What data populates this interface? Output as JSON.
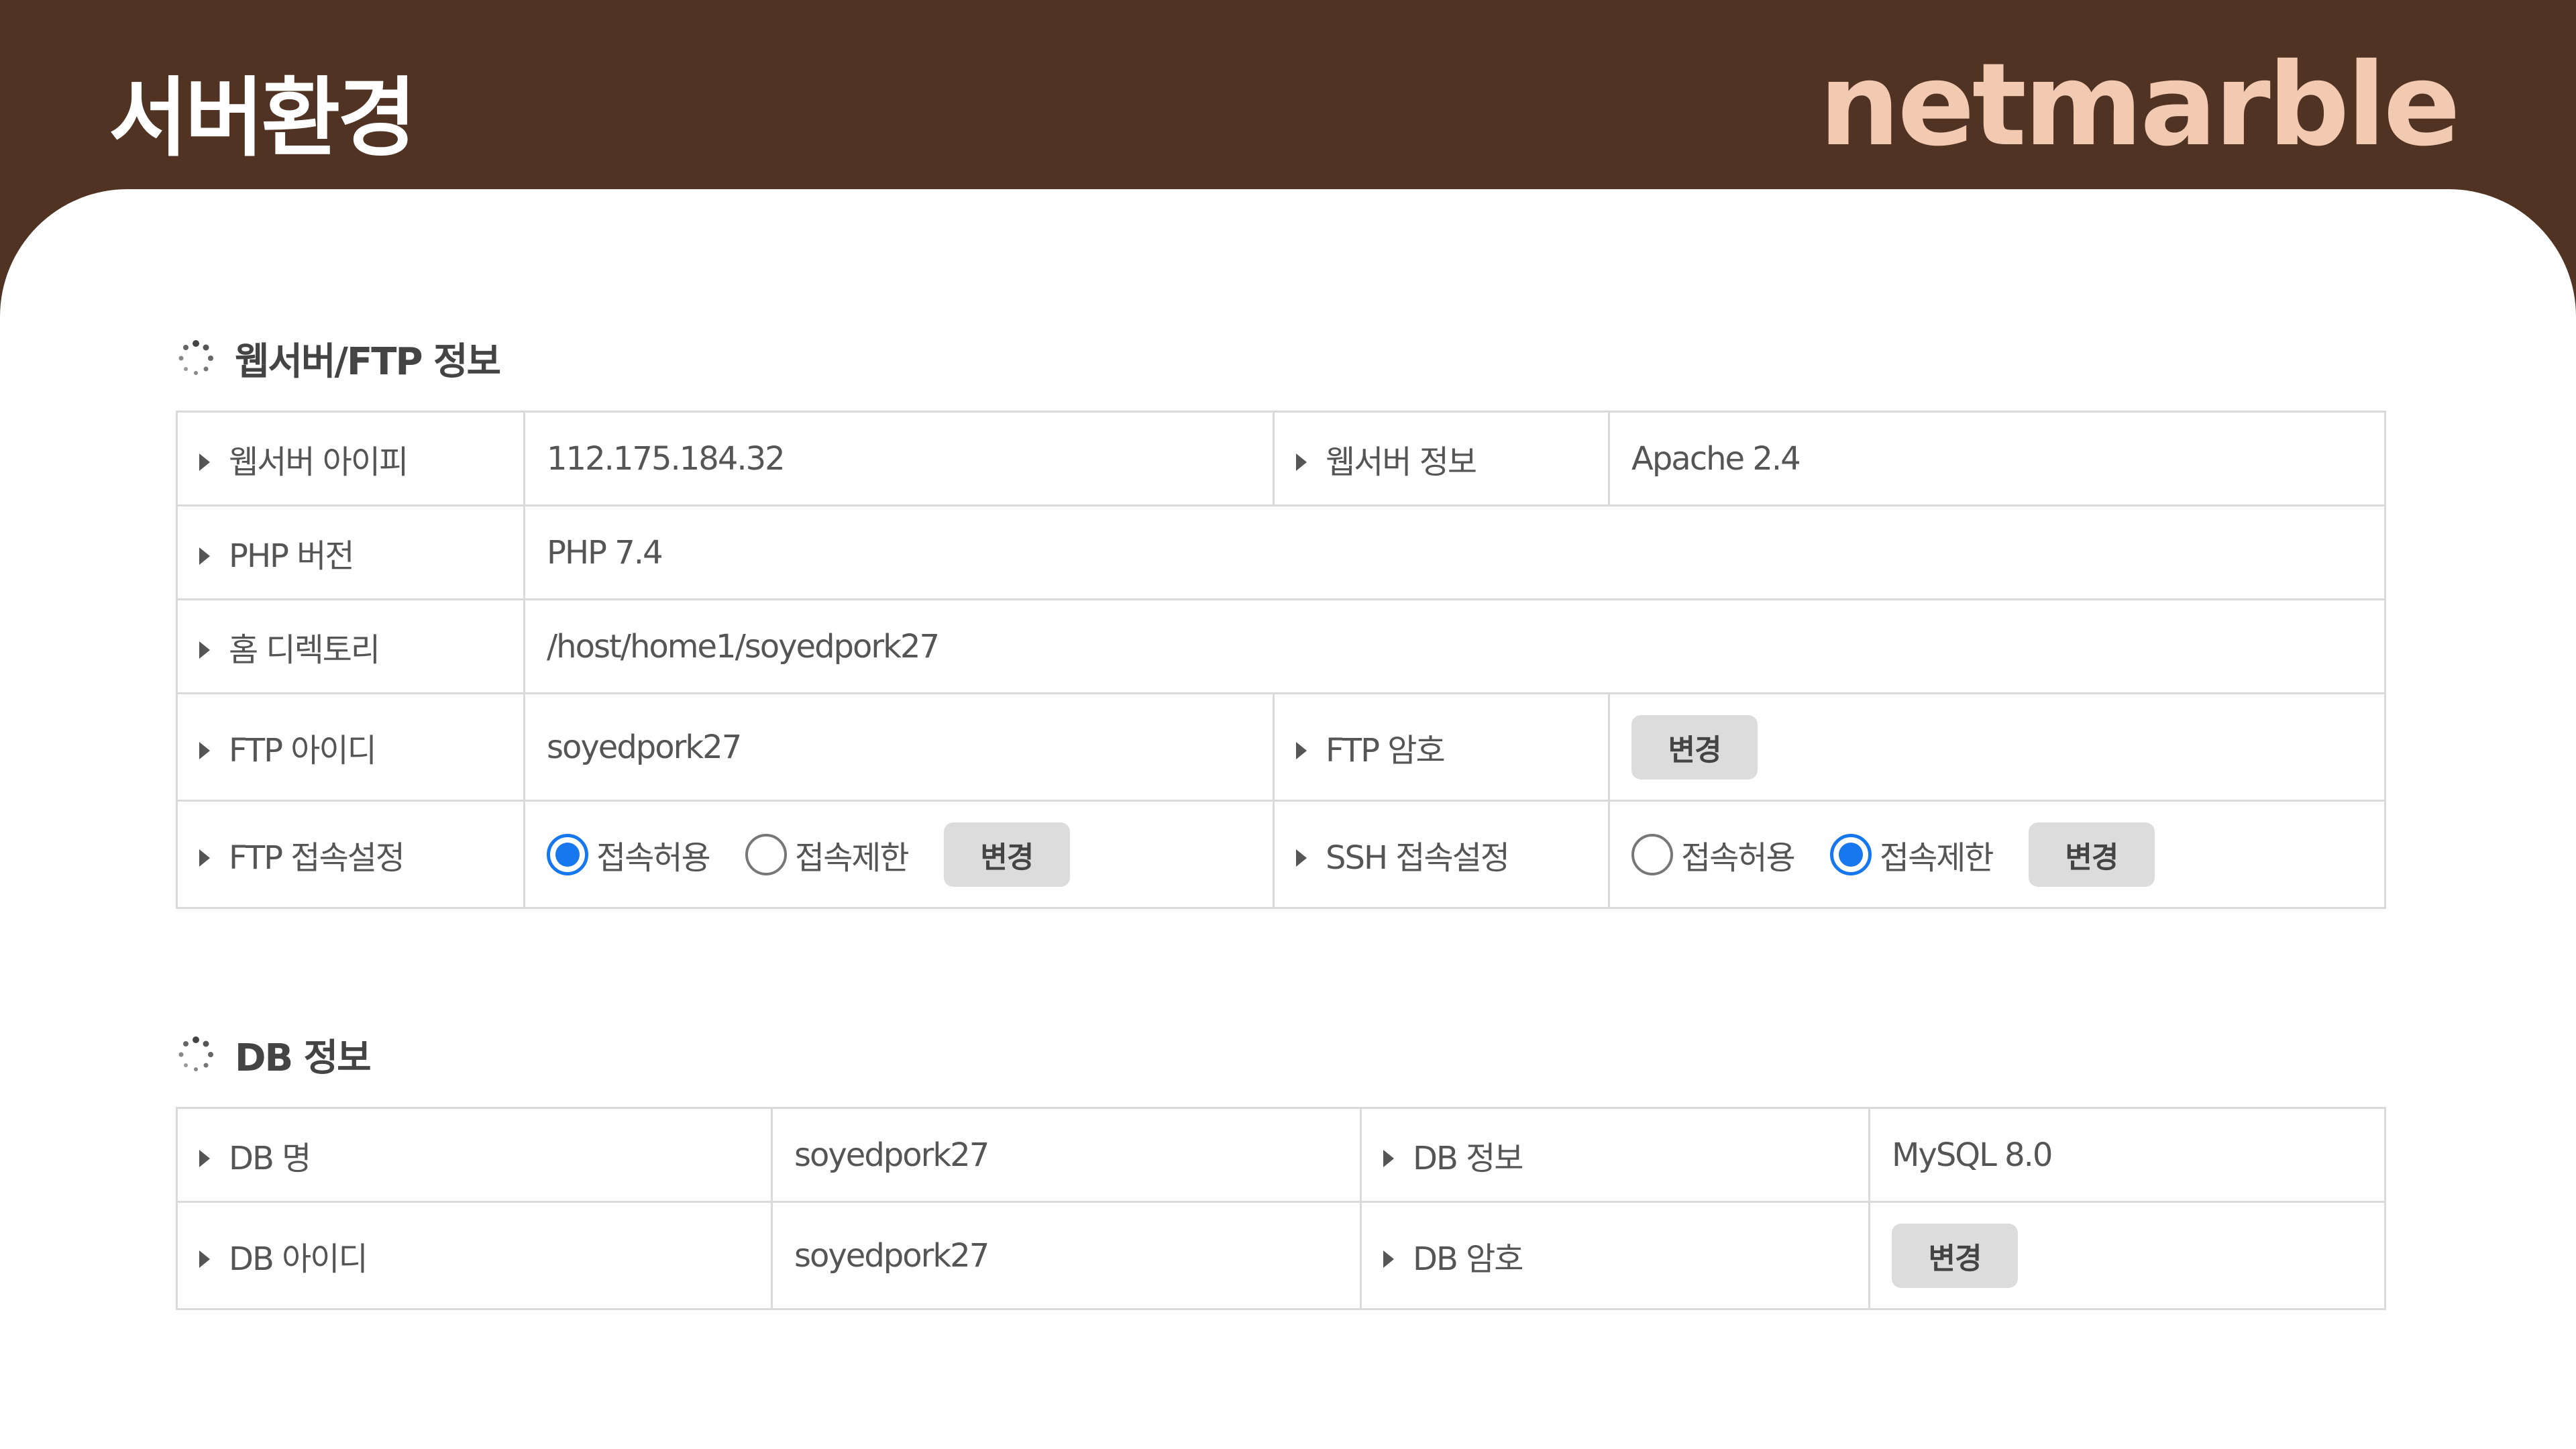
{
  "header": {
    "title": "서버환경",
    "logo": "netmarble"
  },
  "colors": {
    "header_bg": "#513323",
    "logo": "#f2c9b1",
    "accent_red": "#ee2222",
    "radio_blue": "#1677ee"
  },
  "web_section": {
    "title": "웹서버/FTP 정보",
    "rows": {
      "ip_label": "웹서버 아이피",
      "ip_value": "112.175.184.32",
      "webinfo_label": "웹서버 정보",
      "webinfo_value": "Apache 2.4",
      "php_label": "PHP 버전",
      "php_value": "PHP 7.4",
      "home_label": "홈 디렉토리",
      "home_value": "/host/home1/soyedpork27",
      "ftp_id_label": "FTP 아이디",
      "ftp_id_value": "soyedpork27",
      "ftp_pw_label": "FTP 암호",
      "ftp_pw_button": "변경",
      "ftp_access_label": "FTP 접속설정",
      "ftp_allow": "접속허용",
      "ftp_deny": "접속제한",
      "ftp_access_button": "변경",
      "ftp_access_selected": "접속허용",
      "ssh_access_label": "SSH 접속설정",
      "ssh_allow": "접속허용",
      "ssh_deny": "접속제한",
      "ssh_access_button": "변경",
      "ssh_access_selected": "접속제한"
    }
  },
  "db_section": {
    "title": "DB 정보",
    "rows": {
      "name_label": "DB 명",
      "name_value": "soyedpork27",
      "info_label": "DB 정보",
      "info_value": "MySQL 8.0",
      "id_label": "DB 아이디",
      "id_value": "soyedpork27",
      "pw_label": "DB 암호",
      "pw_button": "변경"
    }
  }
}
